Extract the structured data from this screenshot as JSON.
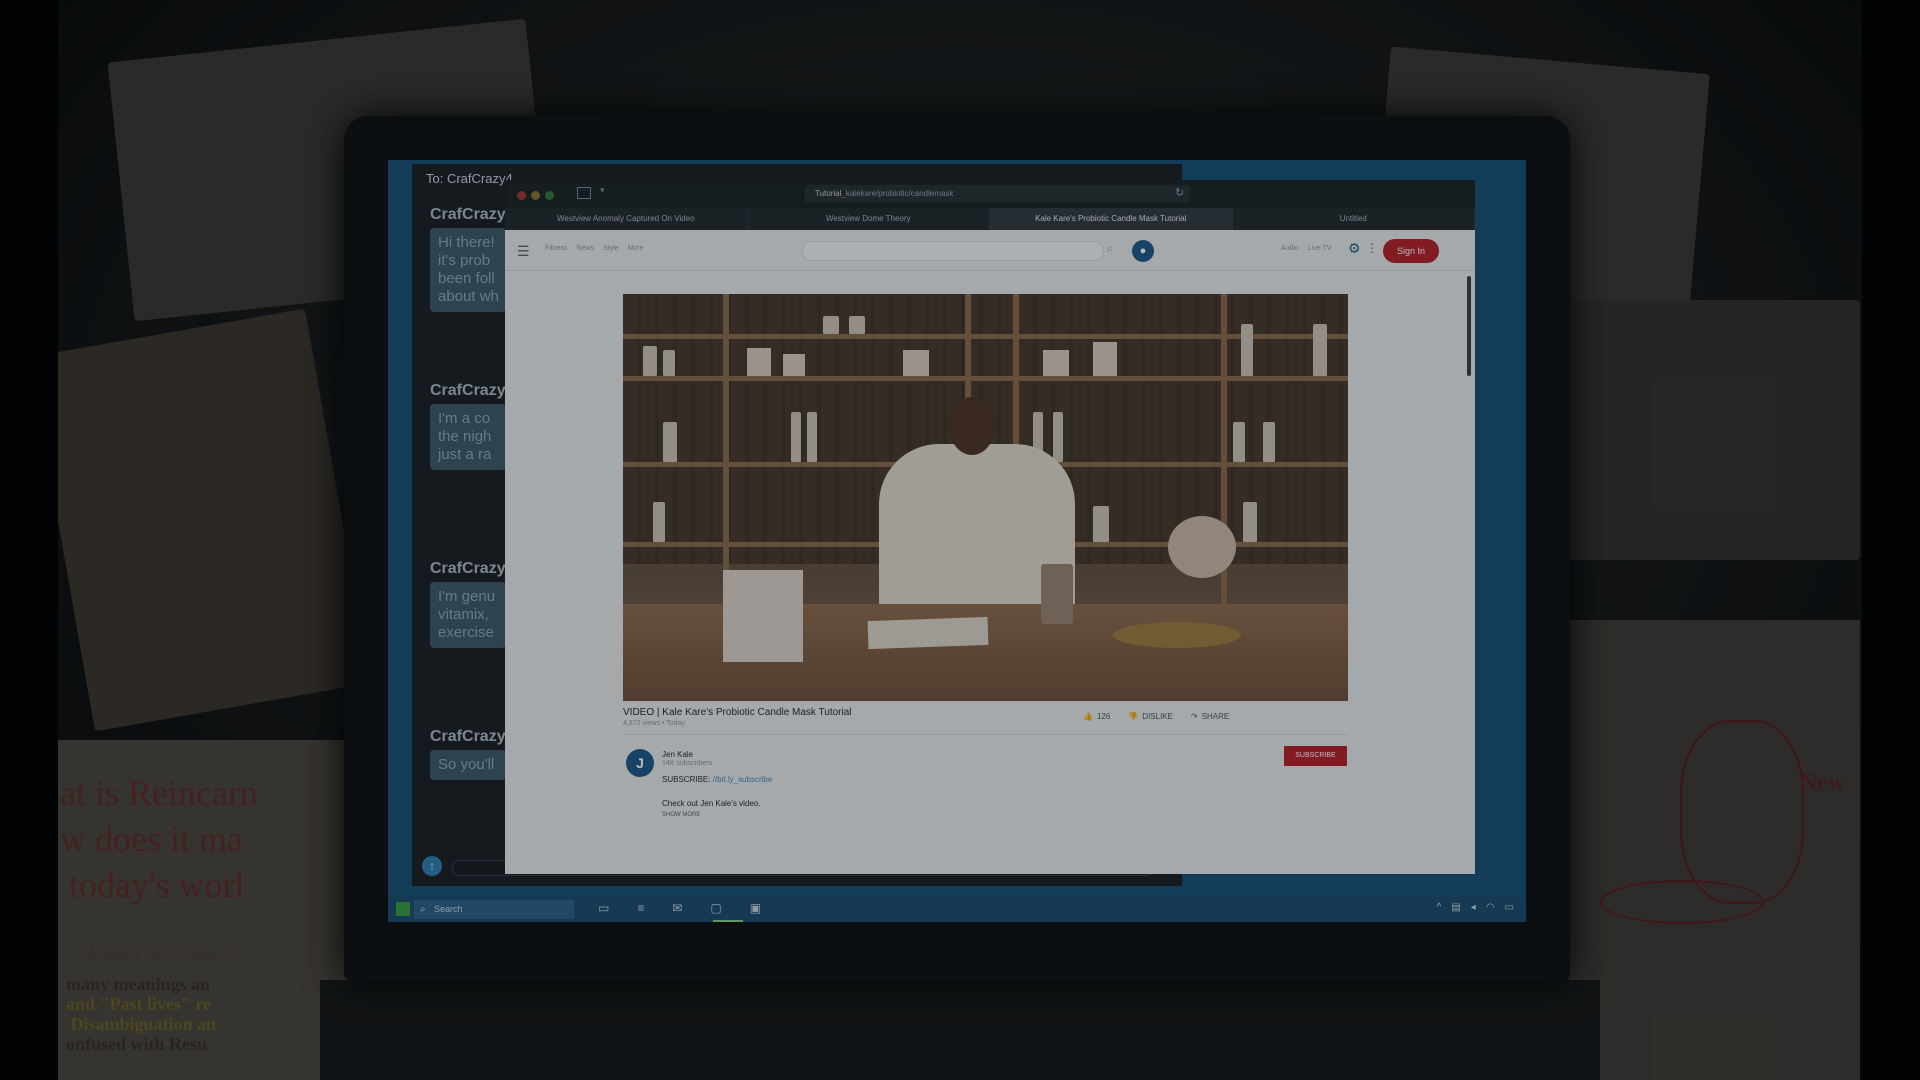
{
  "chat": {
    "header": "To: CrafCrazy4",
    "messages": [
      {
        "name": "CrafCrazy",
        "text": "Hi there!\nit's prob\nbeen foll\nabout wh"
      },
      {
        "name": "CrafCrazy",
        "text": "I'm a co\nthe nigh\njust a ra"
      },
      {
        "name": "CrafCrazy",
        "text": "I'm genu\nvitamix,\nexercise"
      },
      {
        "name": "CrafCrazy",
        "text": "So you'll"
      }
    ]
  },
  "browser": {
    "url_bold": "Tutorial",
    "url_rest": "_kalekare/probiotic/candlemask",
    "tabs": [
      "Westview Anomaly Captured On Video",
      "Westview Dome Theory",
      "Kale Kare's Probiotic Candle Mask Tutorial",
      "Untitled"
    ],
    "nav_links": [
      "Fitness",
      "News",
      "Style",
      "More"
    ],
    "right_links": [
      "Audio",
      "Live TV"
    ],
    "sign_in": "Sign In"
  },
  "video": {
    "title": "VIDEO | Kale Kare's Probiotic Candle Mask Tutorial",
    "meta": "4,872 views • Today",
    "likes": "126",
    "dislike_label": "DISLIKE",
    "share_label": "SHARE",
    "channel": "Jen Kale",
    "subscribers": "14K subscribers",
    "avatar_letter": "J",
    "subscribe_label": "SUBSCRIBE",
    "desc_label": "SUBSCRIBE:",
    "desc_link": "//bit.ly_subscribe",
    "desc_text": "Check out Jen Kale's video.",
    "show_more": "SHOW MORE"
  },
  "taskbar": {
    "search_placeholder": "Search"
  },
  "background": {
    "book_text": "at is Reincarn\nw does it ma\n today's worl",
    "book_subtitle": "A Study by Cynthia C",
    "book_lines_1": "many meanings an",
    "book_lines_2": "and \"Past lives\" re",
    "book_lines_3": " Disambiguation an",
    "book_lines_4": "onfused with Resu",
    "map_label": "New"
  }
}
